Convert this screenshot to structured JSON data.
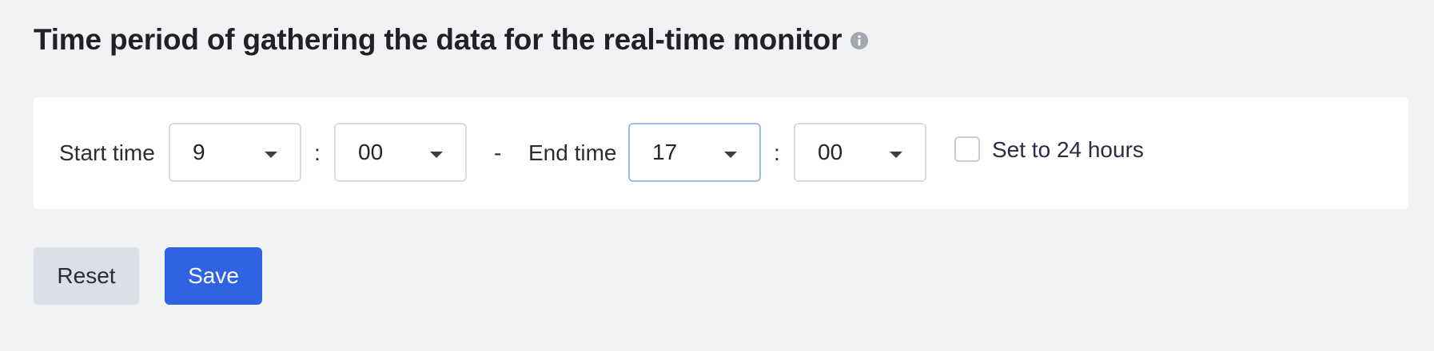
{
  "header": {
    "title": "Time period of gathering the data for the real-time monitor",
    "info_icon": "info-circle-icon"
  },
  "period": {
    "start_label": "Start time",
    "start_hour": "9",
    "start_minute": "00",
    "time_separator": ":",
    "range_separator": "-",
    "end_label": "End time",
    "end_hour": "17",
    "end_minute": "00",
    "set_24h_label": "Set to 24 hours",
    "set_24h_checked": false
  },
  "actions": {
    "reset_label": "Reset",
    "save_label": "Save"
  },
  "colors": {
    "page_bg": "#f1f2f4",
    "card_bg": "#ffffff",
    "primary": "#2f63e3",
    "secondary_button": "#dcdfe5",
    "focus_border": "#9dbbe6"
  }
}
